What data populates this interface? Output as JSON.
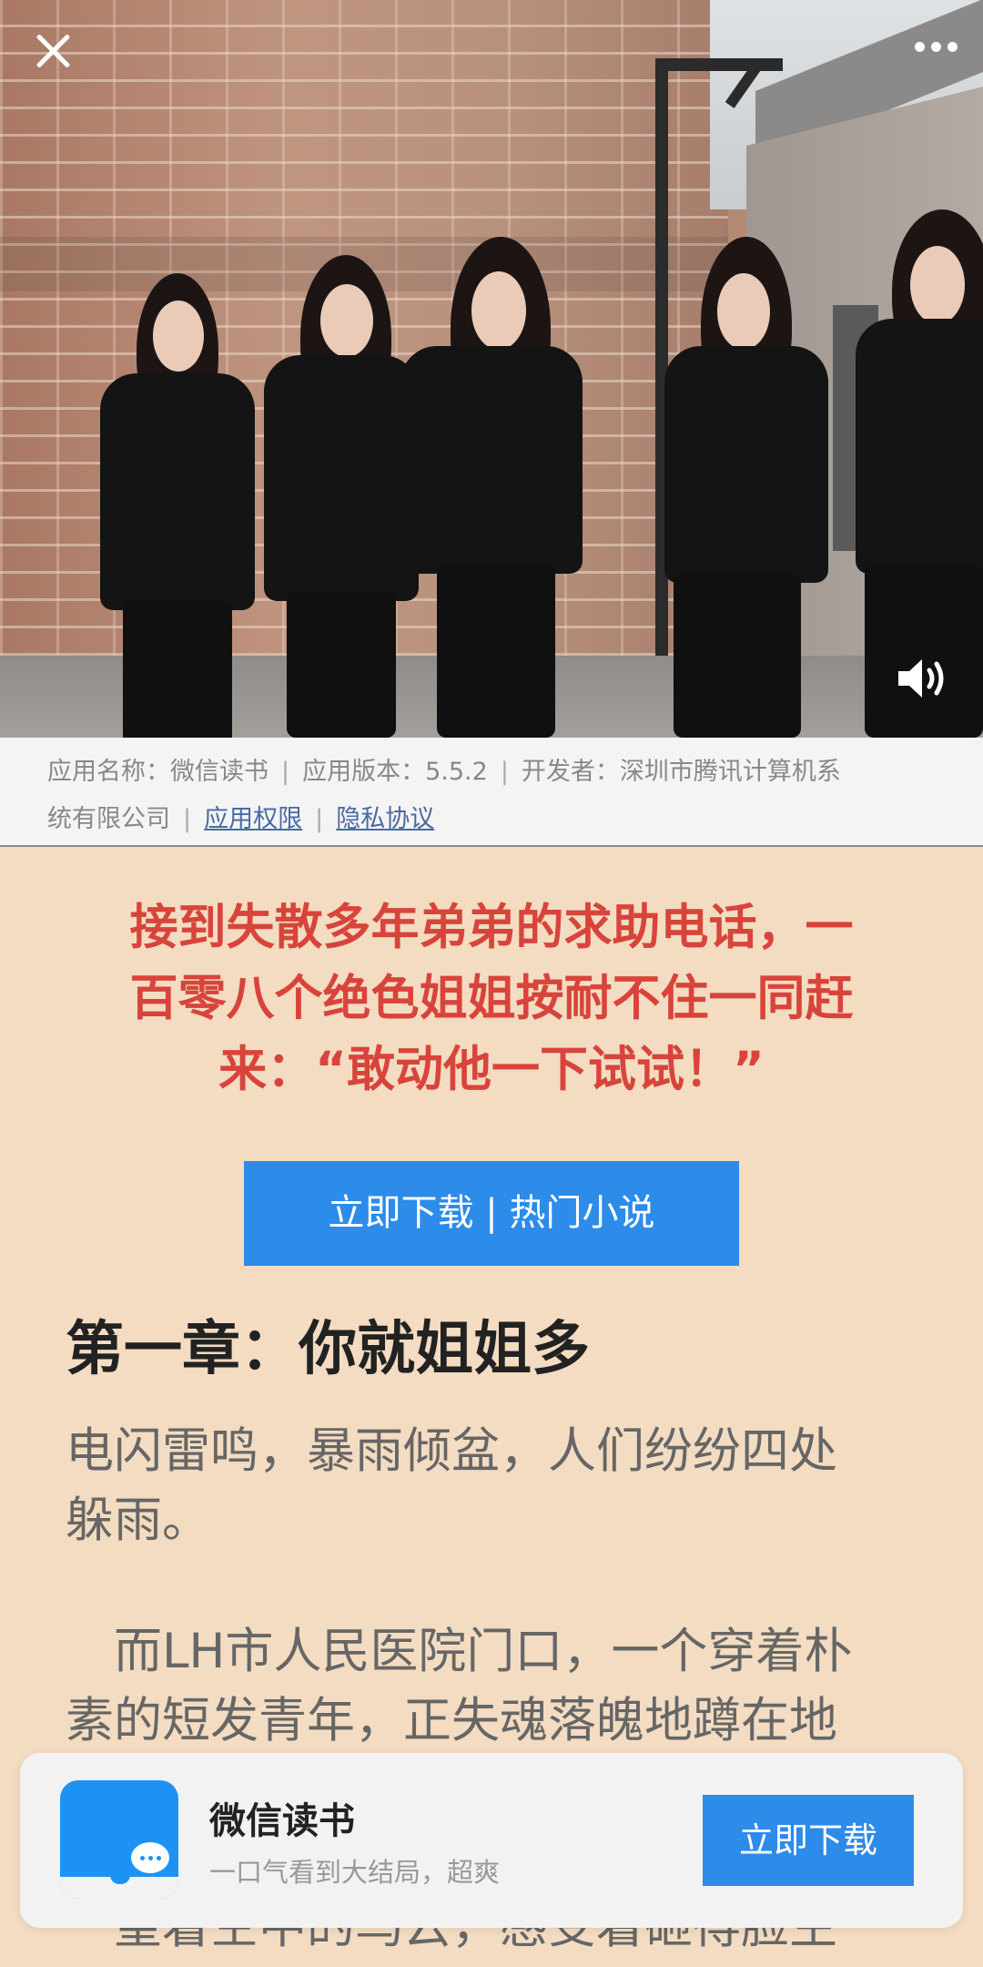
{
  "video": {
    "close_icon": "close-icon",
    "more_icon": "more-dots-icon",
    "sound_icon": "speaker-icon"
  },
  "app_info": {
    "name": "应用名称：微信读书",
    "version": "应用版本：5.5.2",
    "developer_line1": "开发者：深圳市腾讯计算机系",
    "developer_line2": "统有限公司",
    "permissions": "应用权限",
    "privacy": "隐私协议",
    "separator": "|"
  },
  "promo": {
    "title_line1": "接到失散多年弟弟的求助电话，一",
    "title_line2": "百零八个绝色姐姐按耐不住一同赶",
    "title_line3": "来：“敢动他一下试试！”",
    "download_button": "立即下载 | 热门小说",
    "title_color": "#d8443b",
    "accent_color": "#2d8bea"
  },
  "article": {
    "chapter_title": "第一章：你就姐姐多",
    "p1_line1": "电闪雷鸣，暴雨倾盆，人们纷纷四处",
    "p1_line2": "躲雨。",
    "p2_line1": "　而LH市人民医院门口，一个穿着朴",
    "p2_line2": "素的短发青年，正失魂落魄地蹲在地",
    "p3_line1": "　望着空中的乌云，感受着砸得脸生"
  },
  "banner": {
    "app_name": "微信读书",
    "tagline": "一口气看到大结局，超爽",
    "button": "立即下载",
    "icon": "weread-app-icon"
  }
}
